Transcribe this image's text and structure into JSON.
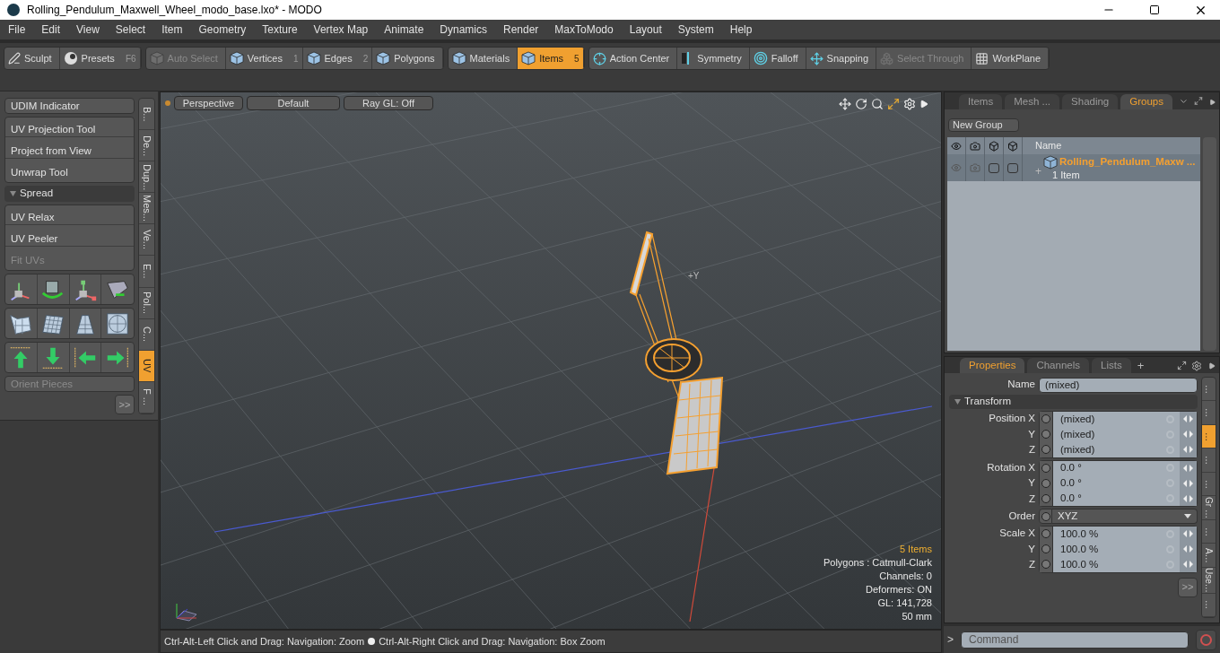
{
  "window": {
    "title": "Rolling_Pendulum_Maxwell_Wheel_modo_base.lxo* - MODO"
  },
  "menu": [
    "File",
    "Edit",
    "View",
    "Select",
    "Item",
    "Geometry",
    "Texture",
    "Vertex Map",
    "Animate",
    "Dynamics",
    "Render",
    "MaxToModo",
    "Layout",
    "System",
    "Help"
  ],
  "toolbar": [
    [
      {
        "label": "Sculpt",
        "selected": false,
        "disabled": false
      },
      {
        "label": "Presets",
        "shortcut": "F6",
        "selected": false,
        "disabled": false
      }
    ],
    [
      {
        "label": "Auto Select",
        "selected": false,
        "disabled": true
      },
      {
        "label": "Vertices",
        "shortcut": "1",
        "selected": false,
        "disabled": false
      },
      {
        "label": "Edges",
        "shortcut": "2",
        "selected": false,
        "disabled": false
      },
      {
        "label": "Polygons",
        "selected": false,
        "disabled": false
      }
    ],
    [
      {
        "label": "Materials",
        "selected": false,
        "disabled": false
      },
      {
        "label": "Items",
        "shortcut": "5",
        "selected": true,
        "disabled": false
      }
    ],
    [
      {
        "label": "Action Center",
        "selected": false,
        "disabled": false
      },
      {
        "label": "Symmetry",
        "selected": false,
        "disabled": false
      },
      {
        "label": "Falloff",
        "selected": false,
        "disabled": false
      },
      {
        "label": "Snapping",
        "selected": false,
        "disabled": false
      },
      {
        "label": "Select Through",
        "selected": false,
        "disabled": true
      },
      {
        "label": "WorkPlane",
        "selected": false,
        "disabled": false
      }
    ]
  ],
  "tool_panel": {
    "udim": "UDIM Indicator",
    "groups": [
      [
        {
          "label": "UV Projection Tool",
          "disabled": false
        },
        {
          "label": "Project from View",
          "disabled": false
        },
        {
          "label": "Unwrap Tool",
          "disabled": false
        }
      ],
      [
        {
          "label": "UV Relax",
          "disabled": false
        },
        {
          "label": "UV Peeler",
          "disabled": false
        },
        {
          "label": "Fit UVs",
          "disabled": true
        }
      ]
    ],
    "section": {
      "label": "Spread",
      "expanded": true
    },
    "orient": {
      "label": "Orient Pieces",
      "disabled": true
    },
    "more": ">>",
    "tabs": [
      {
        "label": "B...",
        "selected": false
      },
      {
        "label": "De...",
        "selected": false
      },
      {
        "label": "Dup...",
        "selected": false
      },
      {
        "label": "Mes...",
        "selected": false
      },
      {
        "label": "Ve...",
        "selected": false
      },
      {
        "label": "E...",
        "selected": false
      },
      {
        "label": "Pol...",
        "selected": false
      },
      {
        "label": "C...",
        "selected": false
      },
      {
        "label": "UV",
        "selected": true
      },
      {
        "label": "F ...",
        "selected": false
      }
    ]
  },
  "viewport": {
    "buttons": [
      "Perspective",
      "Default",
      "Ray GL: Off"
    ],
    "axis_label": "+Y",
    "info": [
      {
        "text": "5 Items",
        "highlight": true
      },
      {
        "text": "Polygons : Catmull-Clark",
        "highlight": false
      },
      {
        "text": "Channels: 0",
        "highlight": false
      },
      {
        "text": "Deformers: ON",
        "highlight": false
      },
      {
        "text": "GL: 141,728",
        "highlight": false
      },
      {
        "text": "50 mm",
        "highlight": false
      }
    ],
    "status": [
      "Ctrl-Alt-Left Click and Drag: Navigation: Zoom",
      "Ctrl-Alt-Right Click and Drag: Navigation: Box Zoom"
    ]
  },
  "groups_panel": {
    "tabs": [
      {
        "label": "Items",
        "selected": false
      },
      {
        "label": "Mesh ...",
        "selected": false
      },
      {
        "label": "Shading",
        "selected": false
      },
      {
        "label": "Groups",
        "selected": true
      }
    ],
    "new_group": "New Group",
    "name_column": "Name",
    "rows": [
      {
        "name": "Rolling_Pendulum_Maxw ...",
        "count": "1 Item",
        "expand": "+",
        "render_checked": false,
        "lock_checked": false
      }
    ]
  },
  "properties": {
    "tabs": [
      {
        "label": "Properties",
        "selected": true
      },
      {
        "label": "Channels",
        "selected": false
      },
      {
        "label": "Lists",
        "selected": false
      }
    ],
    "add_tab": "+",
    "name_label": "Name",
    "name_value": "(mixed)",
    "section": {
      "label": "Transform",
      "expanded": true
    },
    "groups": [
      {
        "kind": "vector",
        "rows": [
          {
            "label": "Position X",
            "value": "(mixed)"
          },
          {
            "label": "Y",
            "value": "(mixed)"
          },
          {
            "label": "Z",
            "value": "(mixed)"
          }
        ]
      },
      {
        "kind": "vector",
        "rows": [
          {
            "label": "Rotation X",
            "value": "0.0 °"
          },
          {
            "label": "Y",
            "value": "0.0 °"
          },
          {
            "label": "Z",
            "value": "0.0 °"
          }
        ]
      },
      {
        "kind": "dropdown",
        "label": "Order",
        "value": "XYZ"
      },
      {
        "kind": "vector",
        "rows": [
          {
            "label": "Scale X",
            "value": "100.0 %"
          },
          {
            "label": "Y",
            "value": "100.0 %"
          },
          {
            "label": "Z",
            "value": "100.0 %"
          }
        ]
      }
    ],
    "more": ">>",
    "side_tabs": [
      {
        "label": "…",
        "selected": false
      },
      {
        "label": "…",
        "selected": false
      },
      {
        "label": "…",
        "selected": true
      },
      {
        "label": "…",
        "selected": false
      },
      {
        "label": "…",
        "selected": false
      },
      {
        "label": "Gr …",
        "selected": false
      },
      {
        "label": "…",
        "selected": false
      },
      {
        "label": "A…",
        "selected": false
      },
      {
        "label": "Use…",
        "selected": false
      },
      {
        "label": "…",
        "selected": false
      }
    ]
  },
  "command": {
    "prompt": ">",
    "placeholder": "Command"
  }
}
